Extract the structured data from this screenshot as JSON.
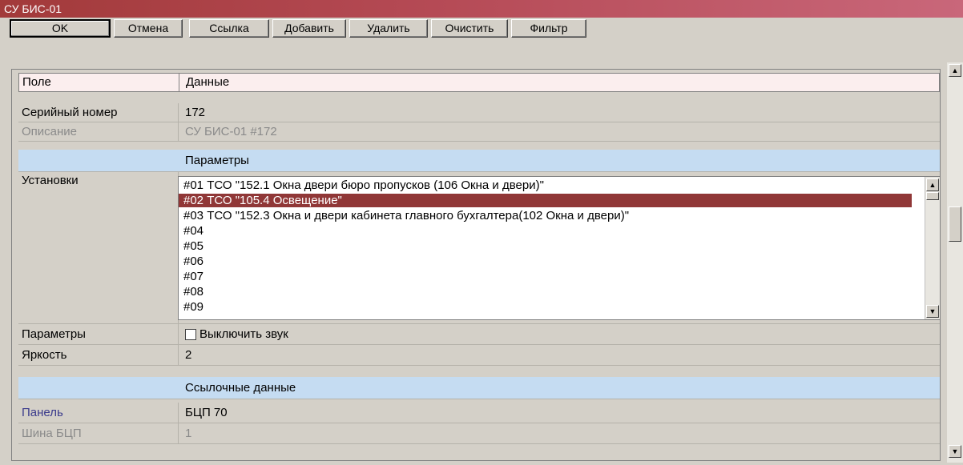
{
  "window": {
    "title": "СУ БИС-01"
  },
  "toolbar": {
    "ok": "OK",
    "cancel": "Отмена",
    "link": "Ссылка",
    "add": "Добавить",
    "delete": "Удалить",
    "clear": "Очистить",
    "filter": "Фильтр"
  },
  "grid": {
    "header": {
      "field": "Поле",
      "data": "Данные"
    },
    "serial": {
      "label": "Серийный номер",
      "value": "172"
    },
    "description": {
      "label": "Описание",
      "value": "СУ БИС-01 #172"
    },
    "section_params": "Параметры",
    "settings": {
      "label": "Установки",
      "items": [
        "#01 ТСО \"152.1 Окна двери бюро пропусков (106 Окна и двери)\"",
        "#02 ТСО \"105.4 Освещение\"",
        "#03 ТСО \"152.3 Окна и двери кабинета главного бухгалтера(102 Окна и двери)\"",
        "#04",
        "#05",
        "#06",
        "#07",
        "#08",
        "#09"
      ],
      "selected_index": 1
    },
    "params": {
      "label": "Параметры",
      "checkbox_label": "Выключить звук",
      "checked": false
    },
    "brightness": {
      "label": "Яркость",
      "value": "2"
    },
    "section_ref": "Ссылочные данные",
    "panel": {
      "label": "Панель",
      "value": "БЦП 70"
    },
    "bus": {
      "label": "Шина БЦП",
      "value": "1"
    }
  },
  "icons": {
    "up": "scroll-up-arrow-icon",
    "down": "scroll-down-arrow-icon"
  }
}
